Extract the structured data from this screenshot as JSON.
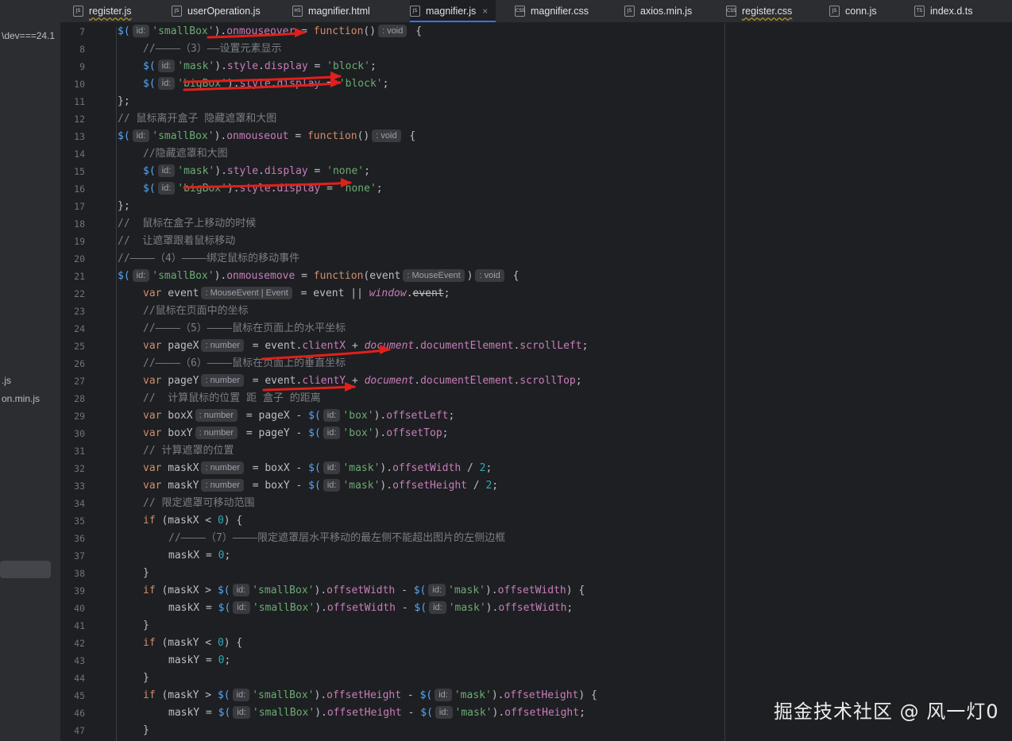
{
  "sidebar": {
    "path_fragment": "\\dev===24.1",
    "file1": ".js",
    "file2": "on.min.js"
  },
  "tabs": [
    {
      "label": "register.js",
      "icon": "JS",
      "active": false
    },
    {
      "label": "userOperation.js",
      "icon": "JS",
      "active": false
    },
    {
      "label": "magnifier.html",
      "icon": "H5",
      "active": false
    },
    {
      "label": "magnifier.js",
      "icon": "JS",
      "active": true
    },
    {
      "label": "magnifier.css",
      "icon": "CSS",
      "active": false
    },
    {
      "label": "axios.min.js",
      "icon": "JS",
      "active": false
    },
    {
      "label": "register.css",
      "icon": "CSS",
      "active": false
    },
    {
      "label": "conn.js",
      "icon": "JS",
      "active": false
    },
    {
      "label": "index.d.ts",
      "icon": "TS",
      "active": false
    }
  ],
  "tab_close_glyph": "×",
  "code_lines": [
    {
      "n": "7",
      "indent": 0,
      "t": [
        [
          "fn",
          "$("
        ],
        [
          "hint",
          "id:"
        ],
        [
          "str",
          "'smallBox'"
        ],
        [
          "t",
          ")."
        ],
        [
          "prop",
          "onmouseover"
        ],
        [
          "t",
          " = "
        ],
        [
          "kw",
          "function"
        ],
        [
          "t",
          "()"
        ],
        [
          "hint",
          ": void"
        ],
        [
          "t",
          " {"
        ]
      ]
    },
    {
      "n": "8",
      "indent": 32,
      "t": [
        [
          "cmt",
          "//————（3）——设置元素显示"
        ]
      ]
    },
    {
      "n": "9",
      "indent": 32,
      "t": [
        [
          "fn",
          "$("
        ],
        [
          "hint",
          "id:"
        ],
        [
          "str",
          "'mask'"
        ],
        [
          "t",
          ")."
        ],
        [
          "prop",
          "style"
        ],
        [
          "t",
          "."
        ],
        [
          "prop",
          "display"
        ],
        [
          "t",
          " = "
        ],
        [
          "str",
          "'block'"
        ],
        [
          "t",
          ";"
        ]
      ]
    },
    {
      "n": "10",
      "indent": 32,
      "t": [
        [
          "fn",
          "$("
        ],
        [
          "hint",
          "id:"
        ],
        [
          "str",
          "'bigBox'"
        ],
        [
          "t",
          ")."
        ],
        [
          "prop",
          "style"
        ],
        [
          "t",
          "."
        ],
        [
          "prop",
          "display"
        ],
        [
          "t",
          " = "
        ],
        [
          "str",
          "'block'"
        ],
        [
          "t",
          ";"
        ]
      ]
    },
    {
      "n": "11",
      "indent": 0,
      "t": [
        [
          "t",
          "};"
        ]
      ]
    },
    {
      "n": "12",
      "indent": 0,
      "t": [
        [
          "cmt",
          "// 鼠标离开盒子 隐藏遮罩和大图"
        ]
      ]
    },
    {
      "n": "13",
      "indent": 0,
      "t": [
        [
          "fn",
          "$("
        ],
        [
          "hint",
          "id:"
        ],
        [
          "str",
          "'smallBox'"
        ],
        [
          "t",
          ")."
        ],
        [
          "prop",
          "onmouseout"
        ],
        [
          "t",
          " = "
        ],
        [
          "kw",
          "function"
        ],
        [
          "t",
          "()"
        ],
        [
          "hint",
          ": void"
        ],
        [
          "t",
          " {"
        ]
      ]
    },
    {
      "n": "14",
      "indent": 32,
      "t": [
        [
          "cmt",
          "//隐藏遮罩和大图"
        ]
      ]
    },
    {
      "n": "15",
      "indent": 32,
      "t": [
        [
          "fn",
          "$("
        ],
        [
          "hint",
          "id:"
        ],
        [
          "str",
          "'mask'"
        ],
        [
          "t",
          ")."
        ],
        [
          "prop",
          "style"
        ],
        [
          "t",
          "."
        ],
        [
          "prop",
          "display"
        ],
        [
          "t",
          " = "
        ],
        [
          "str",
          "'none'"
        ],
        [
          "t",
          ";"
        ]
      ]
    },
    {
      "n": "16",
      "indent": 32,
      "t": [
        [
          "fn",
          "$("
        ],
        [
          "hint",
          "id:"
        ],
        [
          "str",
          "'bigBox'"
        ],
        [
          "t",
          ")."
        ],
        [
          "prop",
          "style"
        ],
        [
          "t",
          "."
        ],
        [
          "prop",
          "display"
        ],
        [
          "t",
          " = "
        ],
        [
          "str",
          "'none'"
        ],
        [
          "t",
          ";"
        ]
      ]
    },
    {
      "n": "17",
      "indent": 0,
      "t": [
        [
          "t",
          "};"
        ]
      ]
    },
    {
      "n": "18",
      "indent": 0,
      "t": [
        [
          "cmt",
          "//  鼠标在盒子上移动的时候"
        ]
      ]
    },
    {
      "n": "19",
      "indent": 0,
      "t": [
        [
          "cmt",
          "//  让遮罩跟着鼠标移动"
        ]
      ]
    },
    {
      "n": "20",
      "indent": 0,
      "t": [
        [
          "cmt",
          "//————（4）————绑定鼠标的移动事件"
        ]
      ]
    },
    {
      "n": "21",
      "indent": 0,
      "t": [
        [
          "fn",
          "$("
        ],
        [
          "hint",
          "id:"
        ],
        [
          "str",
          "'smallBox'"
        ],
        [
          "t",
          ")."
        ],
        [
          "prop",
          "onmousemove"
        ],
        [
          "t",
          " = "
        ],
        [
          "kw",
          "function"
        ],
        [
          "t",
          "(event"
        ],
        [
          "hint",
          ": MouseEvent"
        ],
        [
          "t",
          ")"
        ],
        [
          "hint",
          ": void"
        ],
        [
          "t",
          " {"
        ]
      ]
    },
    {
      "n": "22",
      "indent": 32,
      "t": [
        [
          "kw",
          "var"
        ],
        [
          "t",
          " event"
        ],
        [
          "hint",
          ": MouseEvent | Event"
        ],
        [
          "t",
          " = event || "
        ],
        [
          "gv",
          "window"
        ],
        [
          "t",
          "."
        ],
        [
          "strike",
          "event"
        ],
        [
          "t",
          ";"
        ]
      ]
    },
    {
      "n": "23",
      "indent": 32,
      "t": [
        [
          "cmt",
          "//鼠标在页面中的坐标"
        ]
      ]
    },
    {
      "n": "24",
      "indent": 32,
      "t": [
        [
          "cmt",
          "//————（5）————鼠标在页面上的水平坐标"
        ]
      ]
    },
    {
      "n": "25",
      "indent": 32,
      "t": [
        [
          "kw",
          "var"
        ],
        [
          "t",
          " pageX"
        ],
        [
          "hint",
          ": number"
        ],
        [
          "t",
          " = event."
        ],
        [
          "prop",
          "clientX"
        ],
        [
          "t",
          " + "
        ],
        [
          "gv",
          "document"
        ],
        [
          "t",
          "."
        ],
        [
          "prop",
          "documentElement"
        ],
        [
          "t",
          "."
        ],
        [
          "prop",
          "scrollLeft"
        ],
        [
          "t",
          ";"
        ]
      ]
    },
    {
      "n": "26",
      "indent": 32,
      "t": [
        [
          "cmt",
          "//————（6）————鼠标在页面上的垂直坐标"
        ]
      ]
    },
    {
      "n": "27",
      "indent": 32,
      "t": [
        [
          "kw",
          "var"
        ],
        [
          "t",
          " pageY"
        ],
        [
          "hint",
          ": number"
        ],
        [
          "t",
          " = event."
        ],
        [
          "prop",
          "clientY"
        ],
        [
          "t",
          " + "
        ],
        [
          "gv",
          "document"
        ],
        [
          "t",
          "."
        ],
        [
          "prop",
          "documentElement"
        ],
        [
          "t",
          "."
        ],
        [
          "prop",
          "scrollTop"
        ],
        [
          "t",
          ";"
        ]
      ]
    },
    {
      "n": "28",
      "indent": 32,
      "t": [
        [
          "cmt",
          "//  计算鼠标的位置 距 盒子 的距离"
        ]
      ]
    },
    {
      "n": "29",
      "indent": 32,
      "t": [
        [
          "kw",
          "var"
        ],
        [
          "t",
          " boxX"
        ],
        [
          "hint",
          ": number"
        ],
        [
          "t",
          " = pageX - "
        ],
        [
          "fn",
          "$("
        ],
        [
          "hint",
          "id:"
        ],
        [
          "str",
          "'box'"
        ],
        [
          "t",
          ")."
        ],
        [
          "prop",
          "offsetLeft"
        ],
        [
          "t",
          ";"
        ]
      ]
    },
    {
      "n": "30",
      "indent": 32,
      "t": [
        [
          "kw",
          "var"
        ],
        [
          "t",
          " boxY"
        ],
        [
          "hint",
          ": number"
        ],
        [
          "t",
          " = pageY - "
        ],
        [
          "fn",
          "$("
        ],
        [
          "hint",
          "id:"
        ],
        [
          "str",
          "'box'"
        ],
        [
          "t",
          ")."
        ],
        [
          "prop",
          "offsetTop"
        ],
        [
          "t",
          ";"
        ]
      ]
    },
    {
      "n": "31",
      "indent": 32,
      "t": [
        [
          "cmt",
          "// 计算遮罩的位置"
        ]
      ]
    },
    {
      "n": "32",
      "indent": 32,
      "t": [
        [
          "kw",
          "var"
        ],
        [
          "t",
          " maskX"
        ],
        [
          "hint",
          ": number"
        ],
        [
          "t",
          " = boxX - "
        ],
        [
          "fn",
          "$("
        ],
        [
          "hint",
          "id:"
        ],
        [
          "str",
          "'mask'"
        ],
        [
          "t",
          ")."
        ],
        [
          "prop",
          "offsetWidth"
        ],
        [
          "t",
          " / "
        ],
        [
          "num",
          "2"
        ],
        [
          "t",
          ";"
        ]
      ]
    },
    {
      "n": "33",
      "indent": 32,
      "t": [
        [
          "kw",
          "var"
        ],
        [
          "t",
          " maskY"
        ],
        [
          "hint",
          ": number"
        ],
        [
          "t",
          " = boxY - "
        ],
        [
          "fn",
          "$("
        ],
        [
          "hint",
          "id:"
        ],
        [
          "str",
          "'mask'"
        ],
        [
          "t",
          ")."
        ],
        [
          "prop",
          "offsetHeight"
        ],
        [
          "t",
          " / "
        ],
        [
          "num",
          "2"
        ],
        [
          "t",
          ";"
        ]
      ]
    },
    {
      "n": "34",
      "indent": 32,
      "t": [
        [
          "cmt",
          "// 限定遮罩可移动范围"
        ]
      ]
    },
    {
      "n": "35",
      "indent": 32,
      "t": [
        [
          "kw",
          "if"
        ],
        [
          "t",
          " (maskX < "
        ],
        [
          "num",
          "0"
        ],
        [
          "t",
          ") {"
        ]
      ]
    },
    {
      "n": "36",
      "indent": 64,
      "t": [
        [
          "cmt",
          "//————（7）————限定遮罩层水平移动的最左侧不能超出图片的左侧边框"
        ]
      ]
    },
    {
      "n": "37",
      "indent": 64,
      "t": [
        [
          "t",
          "maskX = "
        ],
        [
          "num",
          "0"
        ],
        [
          "t",
          ";"
        ]
      ]
    },
    {
      "n": "38",
      "indent": 32,
      "t": [
        [
          "t",
          "}"
        ]
      ]
    },
    {
      "n": "39",
      "indent": 32,
      "t": [
        [
          "kw",
          "if"
        ],
        [
          "t",
          " (maskX > "
        ],
        [
          "fn",
          "$("
        ],
        [
          "hint",
          "id:"
        ],
        [
          "str",
          "'smallBox'"
        ],
        [
          "t",
          ")."
        ],
        [
          "prop",
          "offsetWidth"
        ],
        [
          "t",
          " - "
        ],
        [
          "fn",
          "$("
        ],
        [
          "hint",
          "id:"
        ],
        [
          "str",
          "'mask'"
        ],
        [
          "t",
          ")."
        ],
        [
          "prop",
          "offsetWidth"
        ],
        [
          "t",
          ") {"
        ]
      ]
    },
    {
      "n": "40",
      "indent": 64,
      "t": [
        [
          "t",
          "maskX = "
        ],
        [
          "fn",
          "$("
        ],
        [
          "hint",
          "id:"
        ],
        [
          "str",
          "'smallBox'"
        ],
        [
          "t",
          ")."
        ],
        [
          "prop",
          "offsetWidth"
        ],
        [
          "t",
          " - "
        ],
        [
          "fn",
          "$("
        ],
        [
          "hint",
          "id:"
        ],
        [
          "str",
          "'mask'"
        ],
        [
          "t",
          ")."
        ],
        [
          "prop",
          "offsetWidth"
        ],
        [
          "t",
          ";"
        ]
      ]
    },
    {
      "n": "41",
      "indent": 32,
      "t": [
        [
          "t",
          "}"
        ]
      ]
    },
    {
      "n": "42",
      "indent": 32,
      "t": [
        [
          "kw",
          "if"
        ],
        [
          "t",
          " (maskY < "
        ],
        [
          "num",
          "0"
        ],
        [
          "t",
          ") {"
        ]
      ]
    },
    {
      "n": "43",
      "indent": 64,
      "t": [
        [
          "t",
          "maskY = "
        ],
        [
          "num",
          "0"
        ],
        [
          "t",
          ";"
        ]
      ]
    },
    {
      "n": "44",
      "indent": 32,
      "t": [
        [
          "t",
          "}"
        ]
      ]
    },
    {
      "n": "45",
      "indent": 32,
      "t": [
        [
          "kw",
          "if"
        ],
        [
          "t",
          " (maskY > "
        ],
        [
          "fn",
          "$("
        ],
        [
          "hint",
          "id:"
        ],
        [
          "str",
          "'smallBox'"
        ],
        [
          "t",
          ")."
        ],
        [
          "prop",
          "offsetHeight"
        ],
        [
          "t",
          " - "
        ],
        [
          "fn",
          "$("
        ],
        [
          "hint",
          "id:"
        ],
        [
          "str",
          "'mask'"
        ],
        [
          "t",
          ")."
        ],
        [
          "prop",
          "offsetHeight"
        ],
        [
          "t",
          ") {"
        ]
      ]
    },
    {
      "n": "46",
      "indent": 64,
      "t": [
        [
          "t",
          "maskY = "
        ],
        [
          "fn",
          "$("
        ],
        [
          "hint",
          "id:"
        ],
        [
          "str",
          "'smallBox'"
        ],
        [
          "t",
          ")."
        ],
        [
          "prop",
          "offsetHeight"
        ],
        [
          "t",
          " - "
        ],
        [
          "fn",
          "$("
        ],
        [
          "hint",
          "id:"
        ],
        [
          "str",
          "'mask'"
        ],
        [
          "t",
          ")."
        ],
        [
          "prop",
          "offsetHeight"
        ],
        [
          "t",
          ";"
        ]
      ]
    },
    {
      "n": "47",
      "indent": 32,
      "t": [
        [
          "t",
          "}"
        ]
      ]
    }
  ],
  "annotation_color": "#e0201b",
  "watermark": "掘金技术社区 @ 风一灯0"
}
